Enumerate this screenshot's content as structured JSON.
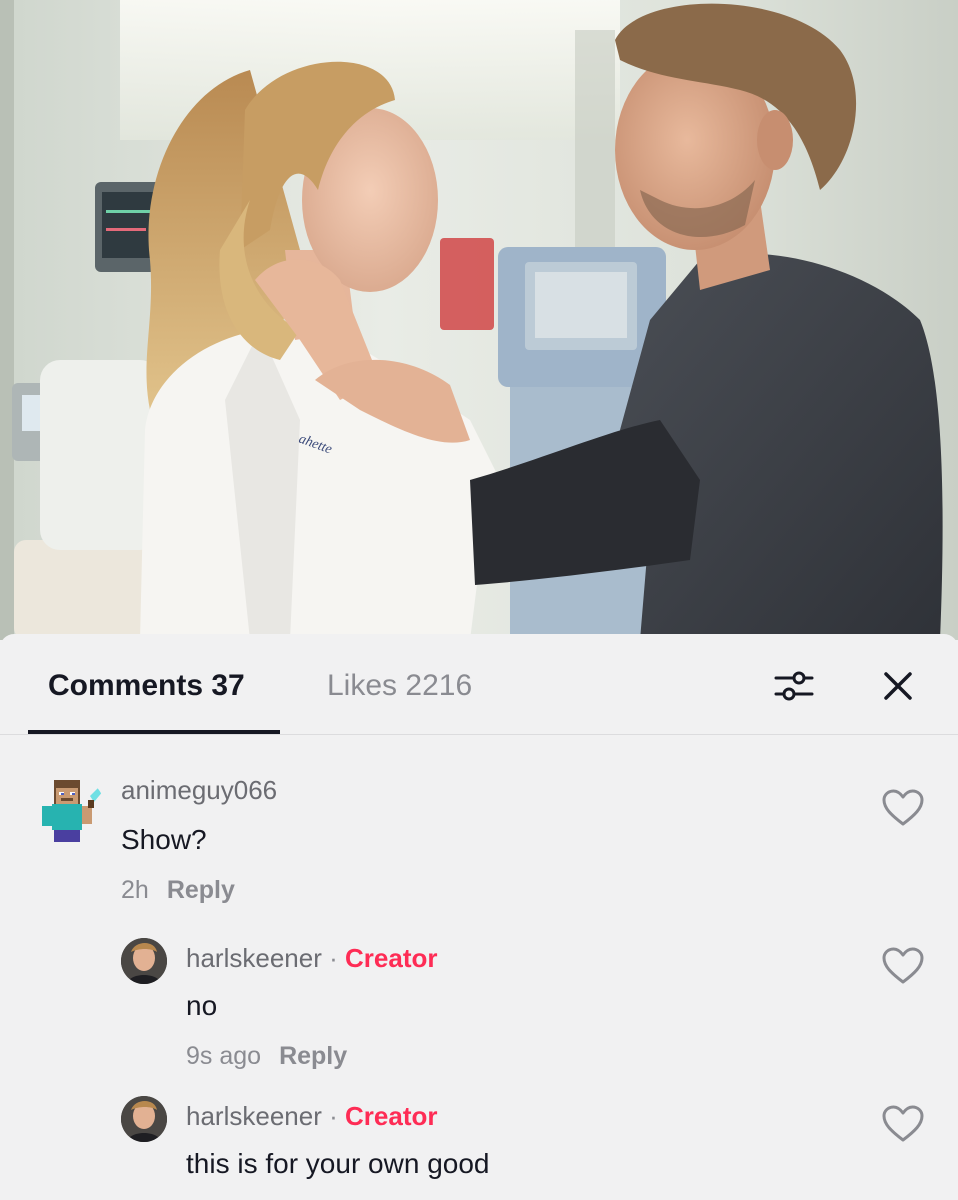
{
  "tabs": {
    "comments_label": "Comments",
    "comments_count": "37",
    "likes_label": "Likes",
    "likes_count": "2216"
  },
  "icons": {
    "filter": "sliders-icon",
    "close": "close-icon",
    "like": "heart-outline-icon"
  },
  "colors": {
    "creator_accent": "#fe2c55",
    "text_primary": "#161823",
    "text_secondary": "#8a8b91",
    "sheet_background": "#f1f1f2"
  },
  "comments": [
    {
      "username": "animeguy066",
      "text": "Show?",
      "time": "2h",
      "reply_label": "Reply"
    },
    {
      "username": "harlskeener",
      "separator": "·",
      "badge": "Creator",
      "text": "no",
      "time": "9s ago",
      "reply_label": "Reply"
    },
    {
      "username": "harlskeener",
      "separator": "·",
      "badge": "Creator",
      "text": "this is for your own good"
    }
  ]
}
